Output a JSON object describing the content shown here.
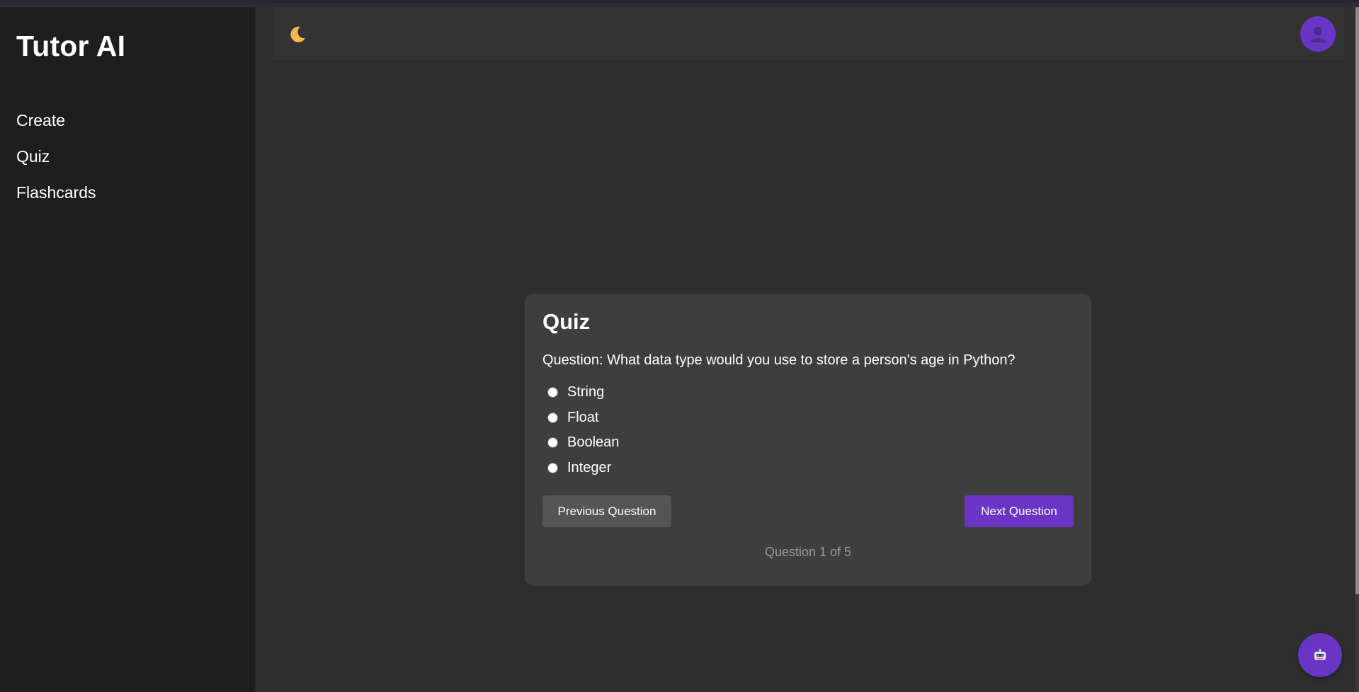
{
  "sidebar": {
    "brand": "Tutor AI",
    "items": [
      {
        "label": "Create"
      },
      {
        "label": "Quiz"
      },
      {
        "label": "Flashcards"
      }
    ]
  },
  "header": {
    "theme_icon": "moon-icon",
    "avatar_icon": "user-icon"
  },
  "quiz": {
    "title": "Quiz",
    "question": "Question: What data type would you use to store a person's age in Python?",
    "options": [
      {
        "label": "String",
        "selected": false
      },
      {
        "label": "Float",
        "selected": false
      },
      {
        "label": "Boolean",
        "selected": false
      },
      {
        "label": "Integer",
        "selected": false
      }
    ],
    "prev_label": "Previous Question",
    "next_label": "Next Question",
    "progress_text": "Question 1 of 5",
    "current_question": 1,
    "total_questions": 5
  },
  "chat_fab": {
    "icon": "robot-icon"
  },
  "colors": {
    "accent": "#6a35c5",
    "sidebar_bg": "#1e1e1e",
    "main_bg": "#2e2e2e",
    "card_bg": "#3e3e3e",
    "secondary_button": "#555555",
    "muted_text": "#9a9a9a",
    "moon": "#f5b94a"
  }
}
